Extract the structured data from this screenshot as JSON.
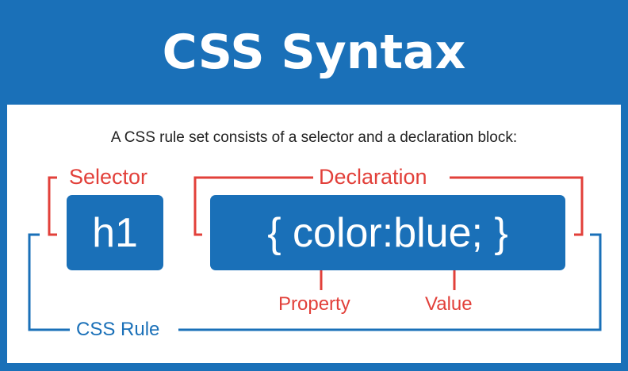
{
  "title": "CSS Syntax",
  "subtitle": "A CSS rule set consists of a selector and a declaration block:",
  "labels": {
    "selector": "Selector",
    "declaration": "Declaration",
    "property": "Property",
    "value": "Value",
    "rule": "CSS Rule"
  },
  "code": {
    "selector": "h1",
    "declaration": "{ color:blue; }"
  },
  "colors": {
    "brand_blue": "#1a70b8",
    "annotation_red": "#e2403a",
    "panel_white": "#ffffff"
  }
}
